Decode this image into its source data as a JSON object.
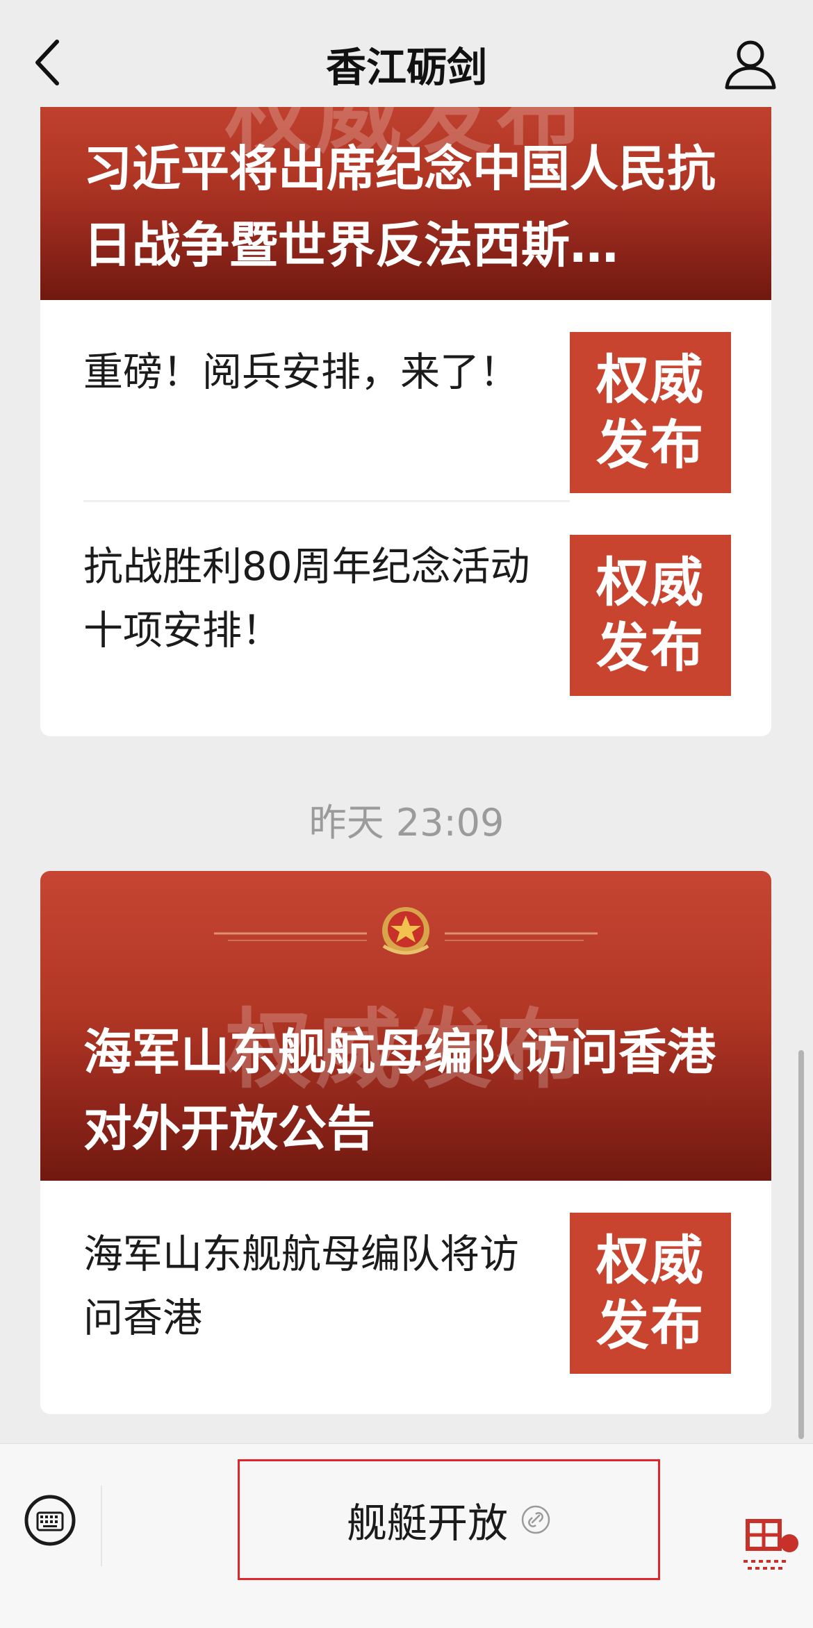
{
  "nav": {
    "title": "香江砺剑",
    "back_icon": "chevron-left-icon",
    "profile_icon": "user-icon"
  },
  "messages": [
    {
      "cover": {
        "watermark": "权威发布",
        "title": "习近平将出席纪念中国人民抗日战争暨世界反法西斯…"
      },
      "items": [
        {
          "title": "重磅！阅兵安排，来了！",
          "thumb_line1": "权威",
          "thumb_line2": "发布"
        },
        {
          "title": "抗战胜利80周年纪念活动十项安排！",
          "thumb_line1": "权威",
          "thumb_line2": "发布"
        }
      ]
    },
    {
      "timestamp": "昨天 23:09",
      "cover": {
        "watermark": "权威发布",
        "title": "海军山东舰航母编队访问香港对外开放公告",
        "emblem_icon": "army-emblem-icon"
      },
      "items": [
        {
          "title": "海军山东舰航母编队将访问香港",
          "thumb_line1": "权威",
          "thumb_line2": "发布"
        }
      ]
    }
  ],
  "bottom_bar": {
    "keyboard_icon": "keyboard-icon",
    "menu_label": "舰艇开放",
    "menu_icon": "link-icon"
  },
  "colors": {
    "cover_red": "#b23725",
    "thumb_red": "#c8442f",
    "highlight_border": "#e0262b",
    "background": "#ededed"
  }
}
